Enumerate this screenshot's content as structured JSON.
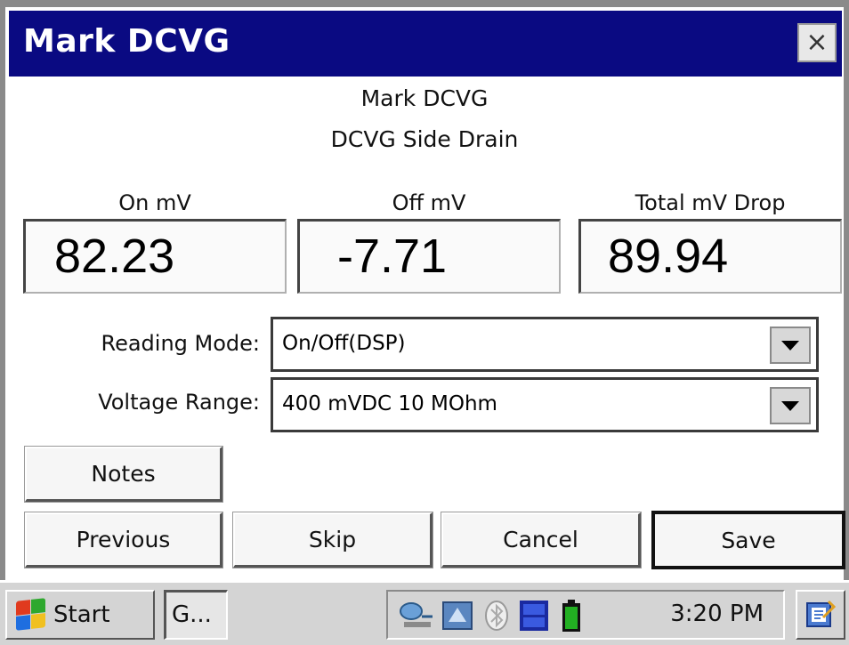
{
  "window": {
    "title": "Mark DCVG",
    "close_glyph": "×"
  },
  "header": {
    "line1": "Mark DCVG",
    "line2": "DCVG Side Drain"
  },
  "readouts": {
    "on": {
      "label": "On mV",
      "value": "82.23"
    },
    "off": {
      "label": "Off mV",
      "value": "-7.71"
    },
    "total": {
      "label": "Total mV Drop",
      "value": "89.94"
    }
  },
  "fields": {
    "reading_mode": {
      "label": "Reading Mode:",
      "value": "On/Off(DSP)"
    },
    "voltage_range": {
      "label": "Voltage Range:",
      "value": "400 mVDC 10 MOhm"
    }
  },
  "buttons": {
    "notes": "Notes",
    "previous": "Previous",
    "skip": "Skip",
    "cancel": "Cancel",
    "save": "Save"
  },
  "taskbar": {
    "start_label": "Start",
    "task_label": "G...",
    "clock": "3:20 PM",
    "tray_icons": [
      "network-icon",
      "sync-icon",
      "bluetooth-icon",
      "dtd-clnt-icon",
      "battery-icon"
    ]
  },
  "colors": {
    "titlebar": "#0a0a82",
    "battery": "#22b022"
  }
}
